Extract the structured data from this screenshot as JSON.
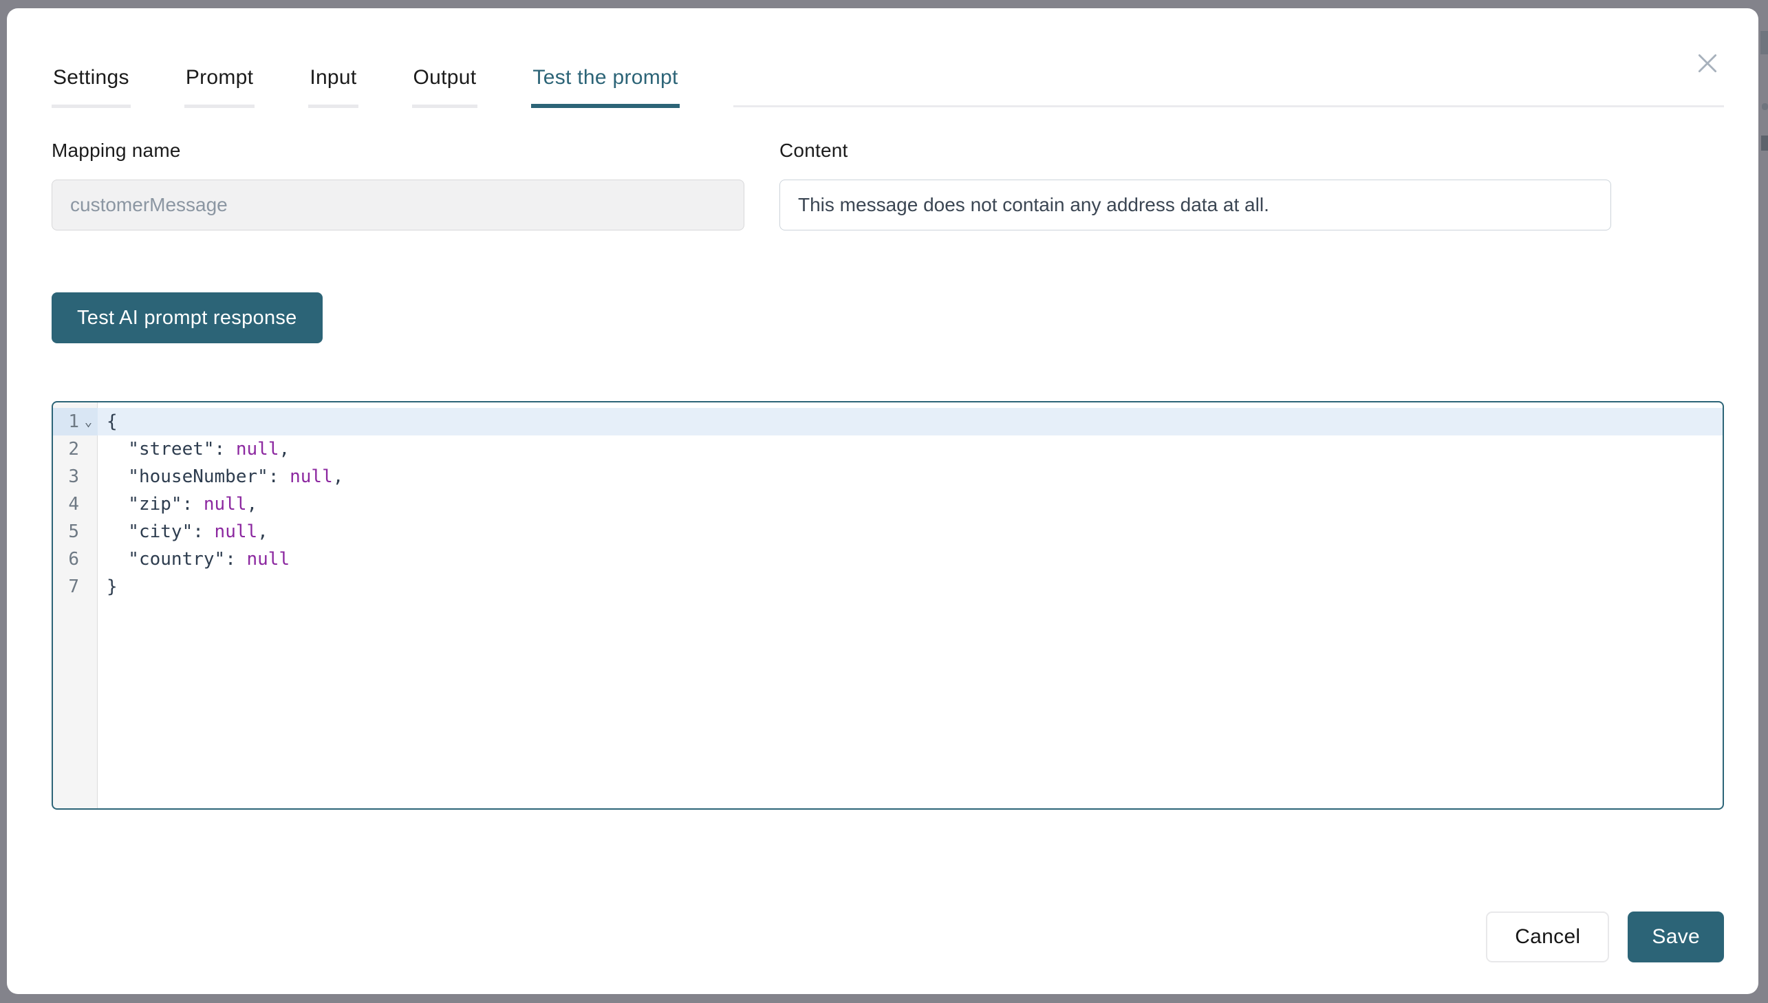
{
  "modal": {
    "tabs": [
      {
        "label": "Settings",
        "active": false
      },
      {
        "label": "Prompt",
        "active": false
      },
      {
        "label": "Input",
        "active": false
      },
      {
        "label": "Output",
        "active": false
      },
      {
        "label": "Test the prompt",
        "active": true
      }
    ],
    "fields": {
      "mapping_name": {
        "label": "Mapping name",
        "value": "customerMessage"
      },
      "content": {
        "label": "Content",
        "value": "This message does not contain any address data at all."
      }
    },
    "test_button_label": "Test AI prompt response",
    "editor": {
      "fold_icon": "⌄",
      "lines": [
        {
          "n": 1,
          "fold": true,
          "active": true,
          "tokens": [
            {
              "t": "{",
              "k": "p"
            }
          ]
        },
        {
          "n": 2,
          "tokens": [
            {
              "t": "  \"street\"",
              "k": "key"
            },
            {
              "t": ": ",
              "k": "p"
            },
            {
              "t": "null",
              "k": "atom"
            },
            {
              "t": ",",
              "k": "p"
            }
          ]
        },
        {
          "n": 3,
          "tokens": [
            {
              "t": "  \"houseNumber\"",
              "k": "key"
            },
            {
              "t": ": ",
              "k": "p"
            },
            {
              "t": "null",
              "k": "atom"
            },
            {
              "t": ",",
              "k": "p"
            }
          ]
        },
        {
          "n": 4,
          "tokens": [
            {
              "t": "  \"zip\"",
              "k": "key"
            },
            {
              "t": ": ",
              "k": "p"
            },
            {
              "t": "null",
              "k": "atom"
            },
            {
              "t": ",",
              "k": "p"
            }
          ]
        },
        {
          "n": 5,
          "tokens": [
            {
              "t": "  \"city\"",
              "k": "key"
            },
            {
              "t": ": ",
              "k": "p"
            },
            {
              "t": "null",
              "k": "atom"
            },
            {
              "t": ",",
              "k": "p"
            }
          ]
        },
        {
          "n": 6,
          "tokens": [
            {
              "t": "  \"country\"",
              "k": "key"
            },
            {
              "t": ": ",
              "k": "p"
            },
            {
              "t": "null",
              "k": "atom"
            }
          ]
        },
        {
          "n": 7,
          "tokens": [
            {
              "t": "}",
              "k": "p"
            }
          ]
        }
      ]
    },
    "footer": {
      "cancel_label": "Cancel",
      "save_label": "Save"
    }
  },
  "colors": {
    "accent_teal": "#2c6477",
    "backdrop_gray": "#83838b",
    "code_null": "#8c28a0",
    "code_default": "#2e3d4f",
    "active_line_blue": "#e6eff9",
    "disabled_text": "#8b96a2",
    "input_border": "#ccd3da"
  }
}
